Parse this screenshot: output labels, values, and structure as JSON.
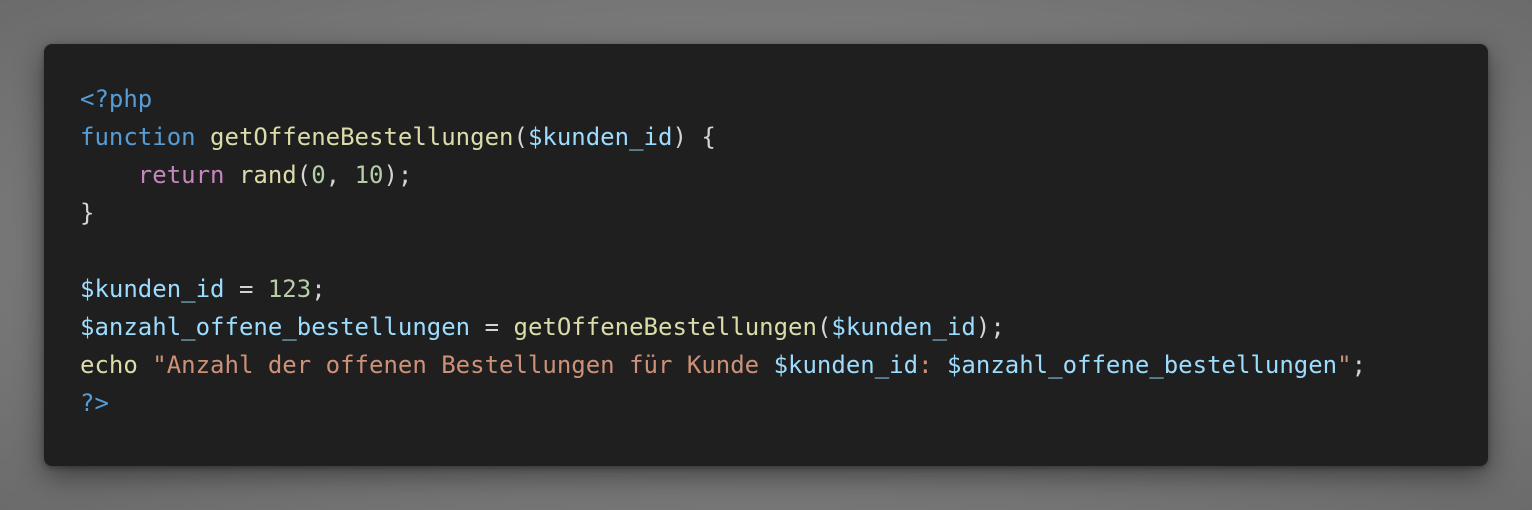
{
  "colors": {
    "background": "#7a7a7a",
    "card": "#1f1f1f",
    "tag": "#569cd6",
    "keyword": "#569cd6",
    "control": "#c586c0",
    "function": "#dcdcaa",
    "variable": "#9cdcfe",
    "number": "#b5cea8",
    "string": "#ce9178",
    "punctuation": "#d4d4d4"
  },
  "code": {
    "language": "php",
    "lines": [
      [
        {
          "t": "<?php",
          "k": "tag"
        }
      ],
      [
        {
          "t": "function",
          "k": "kw"
        },
        {
          "t": " ",
          "k": "punc"
        },
        {
          "t": "getOffeneBestellungen",
          "k": "fn"
        },
        {
          "t": "(",
          "k": "punc"
        },
        {
          "t": "$kunden_id",
          "k": "var"
        },
        {
          "t": ") {",
          "k": "punc"
        }
      ],
      [
        {
          "t": "    ",
          "k": "punc"
        },
        {
          "t": "return",
          "k": "ctrl"
        },
        {
          "t": " ",
          "k": "punc"
        },
        {
          "t": "rand",
          "k": "fn"
        },
        {
          "t": "(",
          "k": "punc"
        },
        {
          "t": "0",
          "k": "num"
        },
        {
          "t": ", ",
          "k": "punc"
        },
        {
          "t": "10",
          "k": "num"
        },
        {
          "t": ");",
          "k": "punc"
        }
      ],
      [
        {
          "t": "}",
          "k": "punc"
        }
      ],
      [],
      [
        {
          "t": "$kunden_id",
          "k": "var"
        },
        {
          "t": " = ",
          "k": "punc"
        },
        {
          "t": "123",
          "k": "num"
        },
        {
          "t": ";",
          "k": "punc"
        }
      ],
      [
        {
          "t": "$anzahl_offene_bestellungen",
          "k": "var"
        },
        {
          "t": " = ",
          "k": "punc"
        },
        {
          "t": "getOffeneBestellungen",
          "k": "fn"
        },
        {
          "t": "(",
          "k": "punc"
        },
        {
          "t": "$kunden_id",
          "k": "var"
        },
        {
          "t": ");",
          "k": "punc"
        }
      ],
      [
        {
          "t": "echo",
          "k": "fn"
        },
        {
          "t": " ",
          "k": "punc"
        },
        {
          "t": "\"Anzahl der offenen Bestellungen für Kunde ",
          "k": "str"
        },
        {
          "t": "$kunden_id",
          "k": "var"
        },
        {
          "t": ": ",
          "k": "str"
        },
        {
          "t": "$anzahl_offene_bestellungen",
          "k": "var"
        },
        {
          "t": "\"",
          "k": "str"
        },
        {
          "t": ";",
          "k": "punc"
        }
      ],
      [
        {
          "t": "?>",
          "k": "tag"
        }
      ]
    ]
  }
}
